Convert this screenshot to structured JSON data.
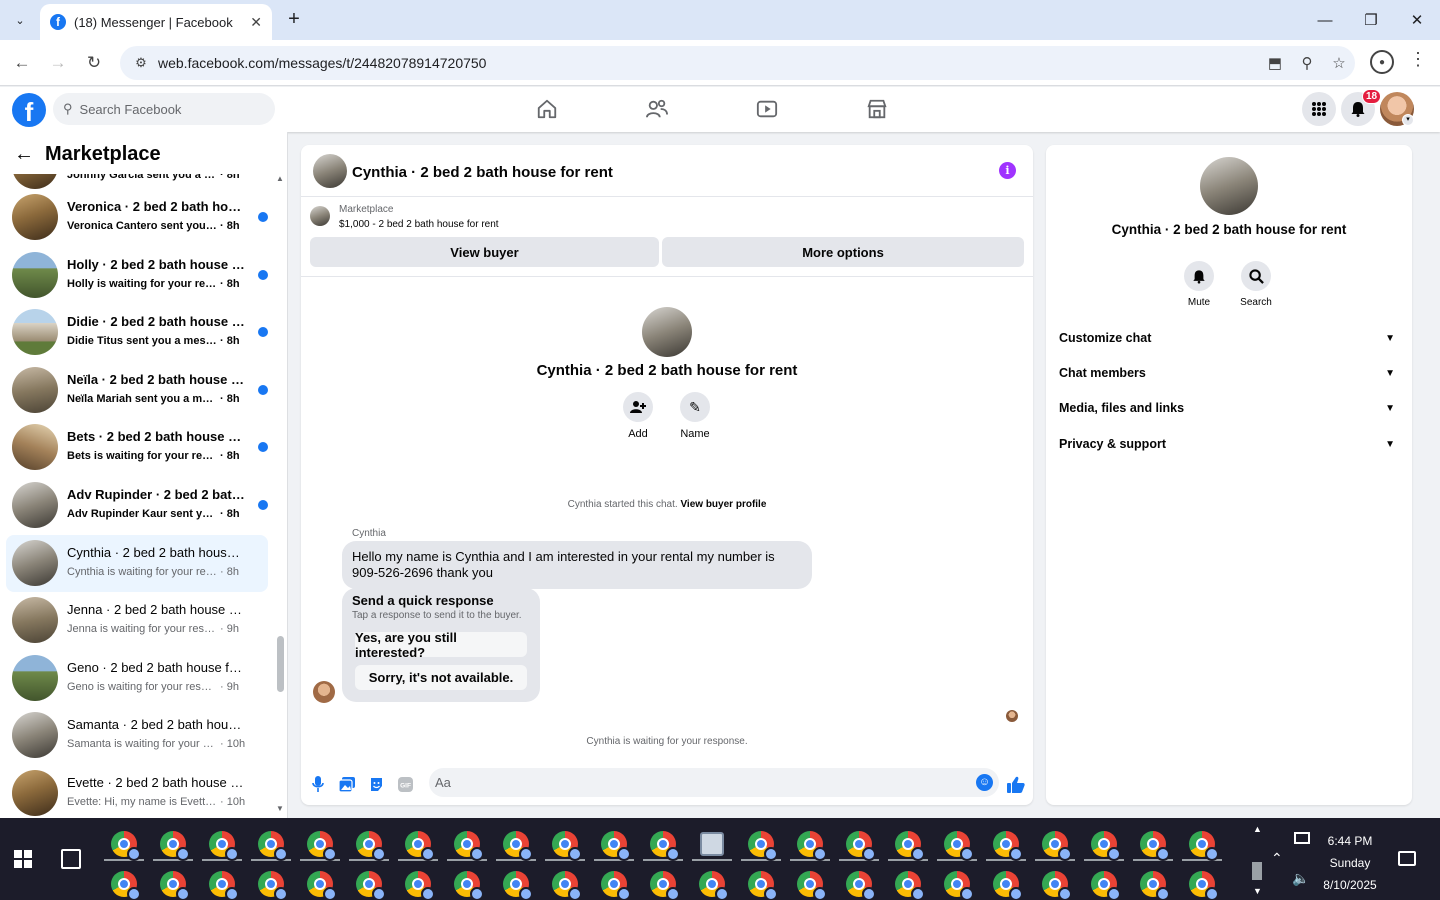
{
  "browser": {
    "tab_title": "(18) Messenger | Facebook",
    "url": "web.facebook.com/messages/t/24482078914720750"
  },
  "fb": {
    "search_placeholder": "Search Facebook",
    "notification_count": "18",
    "brand_color": "#1877f2"
  },
  "sidebar": {
    "title": "Marketplace",
    "conversations": [
      {
        "name": "",
        "preview": "Johnny Garcia sent you a messa...",
        "time": "· 8h",
        "unread": true,
        "thumb": "t-room"
      },
      {
        "name": "Veronica · 2 bed 2 bath house...",
        "preview": "Veronica Cantero sent you a me...",
        "time": "· 8h",
        "unread": true,
        "thumb": "t-room"
      },
      {
        "name": "Holly · 2 bed 2 bath house for...",
        "preview": "Holly is waiting for your respon...",
        "time": "· 8h",
        "unread": true,
        "thumb": "t-house"
      },
      {
        "name": "Didie · 2 bed 2 bath house for...",
        "preview": "Didie Titus sent you a message ...",
        "time": "· 8h",
        "unread": true,
        "thumb": "t-house2"
      },
      {
        "name": "Neïla · 2 bed 2 bath house for...",
        "preview": "Neïla Mariah sent you a messa...",
        "time": "· 8h",
        "unread": true,
        "thumb": "t-patio"
      },
      {
        "name": "Bets · 2 bed 2 bath house for r...",
        "preview": "Bets is waiting for your response.",
        "time": "· 8h",
        "unread": true,
        "thumb": "t-room2"
      },
      {
        "name": "Adv Rupinder · 2 bed 2 bath h...",
        "preview": "Adv Rupinder Kaur sent you a ...",
        "time": "· 8h",
        "unread": true,
        "thumb": "t-bath"
      },
      {
        "name": "Cynthia · 2 bed 2 bath house fo...",
        "preview": "Cynthia is waiting for your response.",
        "time": "· 8h",
        "unread": false,
        "active": true,
        "thumb": "t-bath"
      },
      {
        "name": "Jenna · 2 bed 2 bath house for r...",
        "preview": "Jenna is waiting for your response.",
        "time": "· 9h",
        "unread": false,
        "thumb": "t-patio"
      },
      {
        "name": "Geno · 2 bed 2 bath house for r...",
        "preview": "Geno is waiting for your response.",
        "time": "· 9h",
        "unread": false,
        "thumb": "t-house"
      },
      {
        "name": "Samanta · 2 bed 2 bath house f...",
        "preview": "Samanta is waiting for your resp...",
        "time": "· 10h",
        "unread": false,
        "thumb": "t-bath"
      },
      {
        "name": "Evette · 2 bed 2 bath house for ...",
        "preview": "Evette: Hi, my name is Evette Kah...",
        "time": "· 10h",
        "unread": false,
        "thumb": "t-room"
      }
    ]
  },
  "chat": {
    "title": "Cynthia · 2 bed 2 bath house for rent",
    "listing_category": "Marketplace",
    "listing_price": "$1,000 - 2 bed 2 bath house for rent",
    "view_buyer": "View buyer",
    "more_options": "More options",
    "intro_name": "Cynthia · 2 bed 2 bath house for rent",
    "add_label": "Add",
    "name_label": "Name",
    "started_text": "Cynthia started this chat.",
    "view_profile": "View buyer profile",
    "sender": "Cynthia",
    "message": "Hello my name is Cynthia and I am interested in your rental my number is 909-526-2696 thank you",
    "quick_title": "Send a quick response",
    "quick_sub": "Tap a response to send it to the buyer.",
    "quick_options": [
      "Yes, are you still interested?",
      "Sorry, it's not available."
    ],
    "waiting": "Cynthia is waiting for your response.",
    "composer_placeholder": "Aa"
  },
  "details": {
    "name": "Cynthia · 2 bed 2 bath house for rent",
    "mute": "Mute",
    "search": "Search",
    "sections": [
      "Customize chat",
      "Chat members",
      "Media, files and links",
      "Privacy & support"
    ]
  },
  "taskbar": {
    "time": "6:44 PM",
    "day": "Sunday",
    "date": "8/10/2025"
  }
}
